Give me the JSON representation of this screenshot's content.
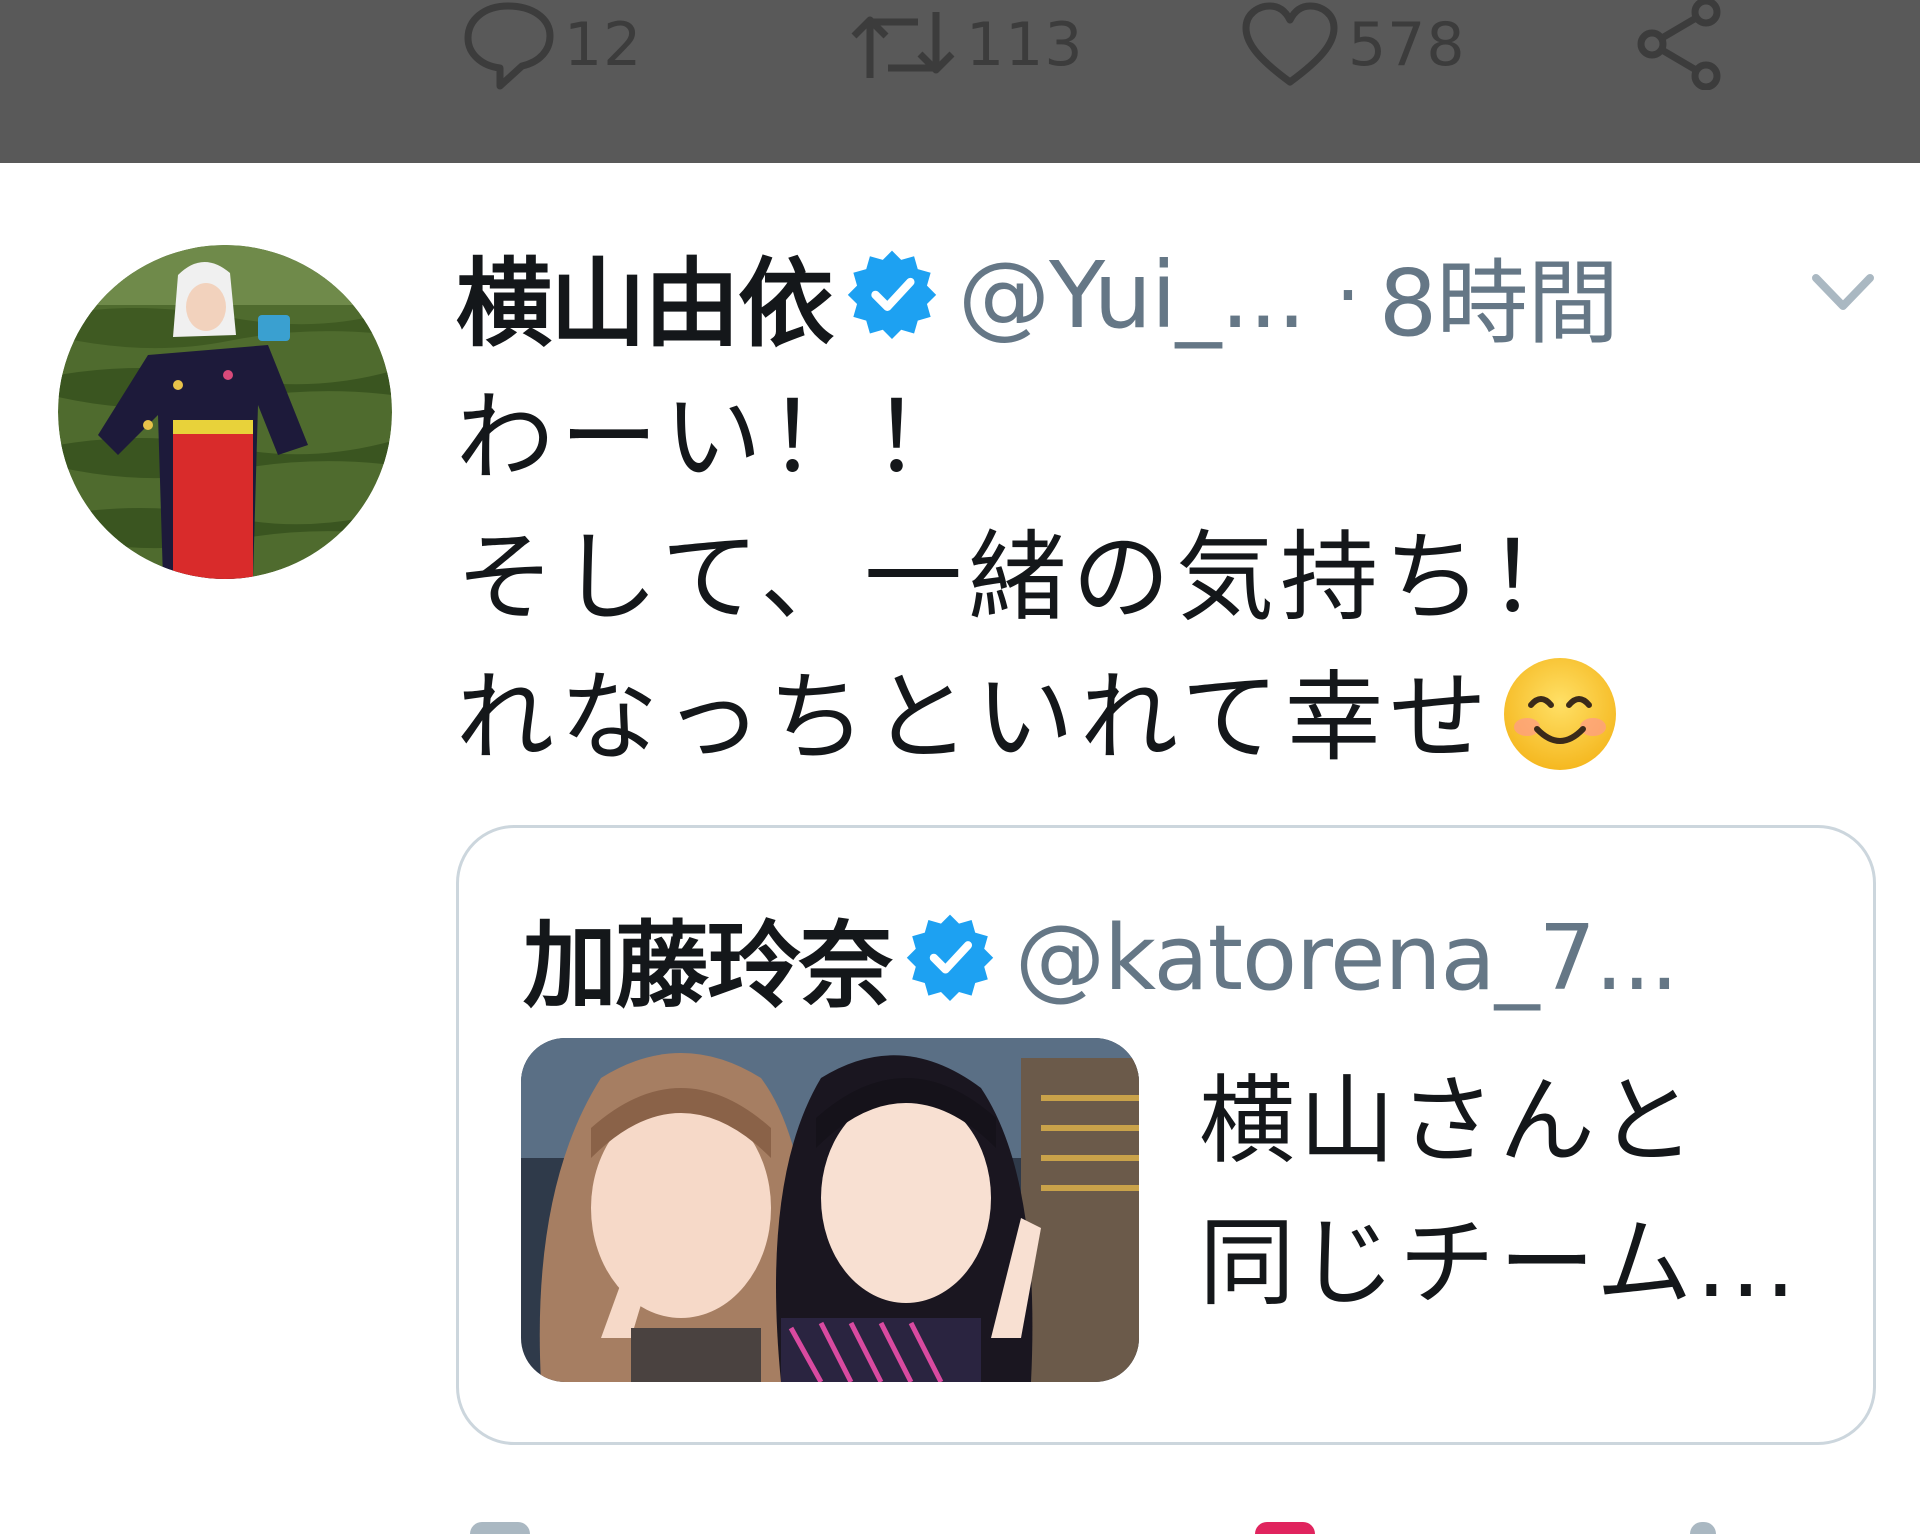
{
  "previous_tweet_actions": {
    "reply_count": "12",
    "retweet_count": "113",
    "like_count": "578"
  },
  "tweet": {
    "display_name": "横山由依",
    "handle": "@Yui_...",
    "separator": "·",
    "time": "8時間",
    "lines": [
      "わーい！！",
      "そして、一緒の気持ち！",
      "れなっちといれて幸せ"
    ],
    "emoji": "smiling-face-with-smiling-eyes"
  },
  "quoted_tweet": {
    "display_name": "加藤玲奈",
    "handle": "@katorena_7...",
    "lines": [
      "横山さんと",
      "同じチーム..."
    ]
  },
  "colors": {
    "verified": "#1da1f2",
    "secondary_text": "#657786",
    "border": "#ccd6dd",
    "dim_overlay": "#595959"
  }
}
